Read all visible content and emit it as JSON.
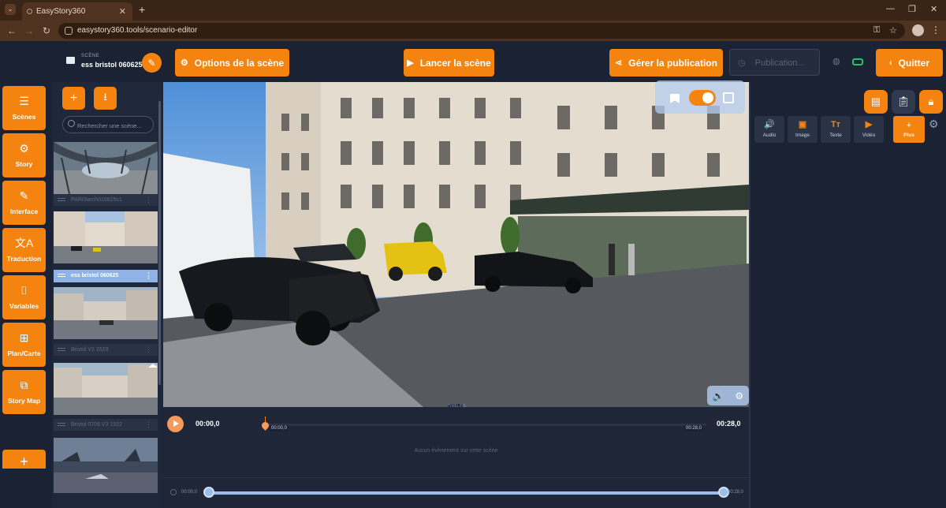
{
  "browser": {
    "tab_title": "EasyStory360",
    "url": "easystory360.tools/scenario-editor"
  },
  "header": {
    "scene_label": "SCÈNE",
    "scene_name": "ess bristol 060625",
    "options_label": "Options de la scène",
    "launch_label": "Lancer la scène",
    "publish_label": "Gérer la publication",
    "publish_status": "Publication...",
    "quit_label": "Quitter"
  },
  "sidebar": {
    "items": [
      {
        "label": "Scènes",
        "icon": "☰"
      },
      {
        "label": "Story",
        "icon": "⚙"
      },
      {
        "label": "Interface",
        "icon": "✎"
      },
      {
        "label": "Traduction",
        "icon": "文A"
      },
      {
        "label": "Variables",
        "icon": "⌷"
      },
      {
        "label": "Plan/Carte",
        "icon": "⊞"
      },
      {
        "label": "Story Map",
        "icon": "⧉"
      }
    ],
    "add_icon": "+"
  },
  "scene_list": {
    "search_placeholder": "Rechercher une scène...",
    "scenes": [
      {
        "name": "PARISarch010625s1",
        "active": false
      },
      {
        "name": "ess bristol 060625",
        "active": true
      },
      {
        "name": "Bristol V2 2629",
        "active": false
      },
      {
        "name": "Bristol 0706 V3 1922",
        "active": false
      }
    ]
  },
  "timeline": {
    "current_time": "00:00,0",
    "total_time": "00:28,0",
    "track_start": "00:00,0",
    "track_end": "00:28,0",
    "empty_message": "Aucun évènement sur cette scène",
    "zoom_start": "00:00,0",
    "zoom_end": "00:28,0",
    "tab_label": "TIMELINE"
  },
  "media_panel": {
    "buttons": [
      {
        "label": "Audio",
        "icon": "🔊"
      },
      {
        "label": "Image",
        "icon": "▣"
      },
      {
        "label": "Texte",
        "icon": "Tт"
      },
      {
        "label": "Vidéo",
        "icon": "▶"
      }
    ],
    "plus_label": "Plus"
  },
  "colors": {
    "accent": "#f5830f",
    "background": "#1b2233",
    "active_scene": "#8fb3e6"
  }
}
